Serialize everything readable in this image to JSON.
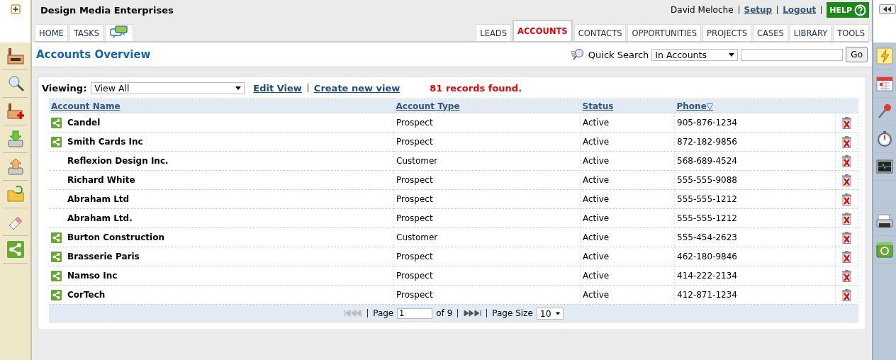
{
  "company": "Design Media Enterprises",
  "user": {
    "name": "David Meloche",
    "links": [
      "Setup",
      "Logout"
    ],
    "help": "HELP"
  },
  "left_tabs": [
    {
      "label": "HOME",
      "kind": "text"
    },
    {
      "label": "TASKS",
      "kind": "text"
    },
    {
      "kind": "chat"
    }
  ],
  "tabs": [
    {
      "label": "LEADS",
      "selected": false
    },
    {
      "label": "ACCOUNTS",
      "selected": true
    },
    {
      "label": "CONTACTS",
      "selected": false
    },
    {
      "label": "OPPORTUNITIES",
      "selected": false
    },
    {
      "label": "PROJECTS",
      "selected": false
    },
    {
      "label": "CASES",
      "selected": false
    },
    {
      "label": "LIBRARY",
      "selected": false
    },
    {
      "label": "TOOLS",
      "selected": false
    }
  ],
  "page_title": "Accounts Overview",
  "quick_search": {
    "label": "Quick Search",
    "scope": "In Accounts",
    "button": "Go"
  },
  "viewing": {
    "label": "Viewing:",
    "value": "View All",
    "links": [
      "Edit View",
      "Create new view"
    ],
    "records": "81 records found."
  },
  "table": {
    "columns": [
      {
        "label": "Account Name"
      },
      {
        "label": "Account Type"
      },
      {
        "label": "Status"
      },
      {
        "label": "Phone",
        "sort": "▽"
      }
    ],
    "rows": [
      {
        "name": "Candel",
        "type": "Prospect",
        "status": "Active",
        "phone": "905-876-1234",
        "shared": true
      },
      {
        "name": "Smith Cards Inc",
        "type": "Prospect",
        "status": "Active",
        "phone": "872-182-9856",
        "shared": true
      },
      {
        "name": "Reflexion Design Inc.",
        "type": "Customer",
        "status": "Active",
        "phone": "568-689-4524",
        "shared": false
      },
      {
        "name": "Richard White",
        "type": "Prospect",
        "status": "Active",
        "phone": "555-555-9088",
        "shared": false
      },
      {
        "name": "Abraham Ltd",
        "type": "Prospect",
        "status": "Active",
        "phone": "555-555-1212",
        "shared": false
      },
      {
        "name": "Abraham Ltd.",
        "type": "Prospect",
        "status": "Active",
        "phone": "555-555-1212",
        "shared": false
      },
      {
        "name": "Burton Construction",
        "type": "Customer",
        "status": "Active",
        "phone": "555-454-2623",
        "shared": true
      },
      {
        "name": "Brasserie Paris",
        "type": "Prospect",
        "status": "Active",
        "phone": "462-180-9846",
        "shared": true
      },
      {
        "name": "Namso Inc",
        "type": "Prospect",
        "status": "Active",
        "phone": "414-222-2134",
        "shared": true
      },
      {
        "name": "CorTech",
        "type": "Prospect",
        "status": "Active",
        "phone": "412-871-1234",
        "shared": true
      }
    ]
  },
  "pager": {
    "page_label": "Page",
    "page": "1",
    "of": "of 9",
    "size_label": "Page Size",
    "size": "10",
    "prev_disabled": true,
    "next_disabled": false
  }
}
